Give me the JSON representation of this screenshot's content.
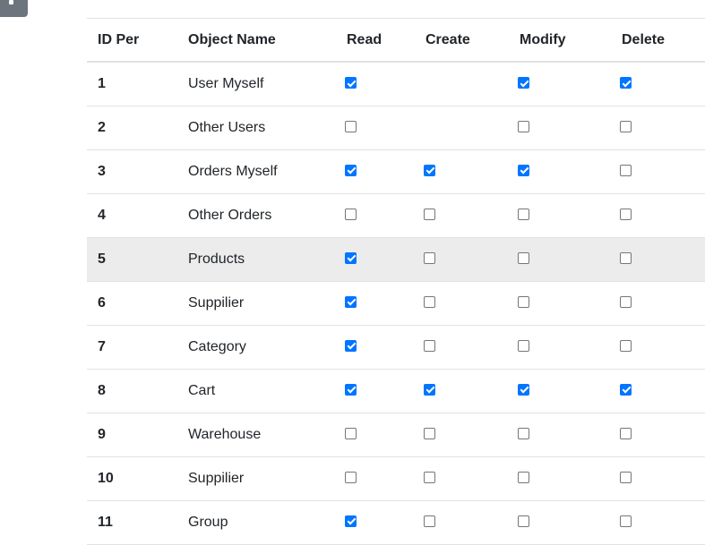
{
  "table": {
    "headers": [
      "ID Per",
      "Object Name",
      "Read",
      "Create",
      "Modify",
      "Delete"
    ],
    "rows": [
      {
        "id": "1",
        "name": "User Myself",
        "read": true,
        "create": null,
        "modify": true,
        "delete": true
      },
      {
        "id": "2",
        "name": "Other Users",
        "read": false,
        "create": null,
        "modify": false,
        "delete": false
      },
      {
        "id": "3",
        "name": "Orders Myself",
        "read": true,
        "create": true,
        "modify": true,
        "delete": false
      },
      {
        "id": "4",
        "name": "Other Orders",
        "read": false,
        "create": false,
        "modify": false,
        "delete": false
      },
      {
        "id": "5",
        "name": "Products",
        "read": true,
        "create": false,
        "modify": false,
        "delete": false,
        "hovered": true
      },
      {
        "id": "6",
        "name": "Suppilier",
        "read": true,
        "create": false,
        "modify": false,
        "delete": false
      },
      {
        "id": "7",
        "name": "Category",
        "read": true,
        "create": false,
        "modify": false,
        "delete": false
      },
      {
        "id": "8",
        "name": "Cart",
        "read": true,
        "create": true,
        "modify": true,
        "delete": true
      },
      {
        "id": "9",
        "name": "Warehouse",
        "read": false,
        "create": false,
        "modify": false,
        "delete": false
      },
      {
        "id": "10",
        "name": "Suppilier",
        "read": false,
        "create": false,
        "modify": false,
        "delete": false
      },
      {
        "id": "11",
        "name": "Group",
        "read": true,
        "create": false,
        "modify": false,
        "delete": false
      }
    ]
  },
  "colors": {
    "accent": "#0075ff",
    "row_hover": "#ececec",
    "border": "#dee2e6",
    "corner_button": "#6c757d"
  },
  "icons": {
    "corner_button_icon": "menu-dot-icon"
  }
}
